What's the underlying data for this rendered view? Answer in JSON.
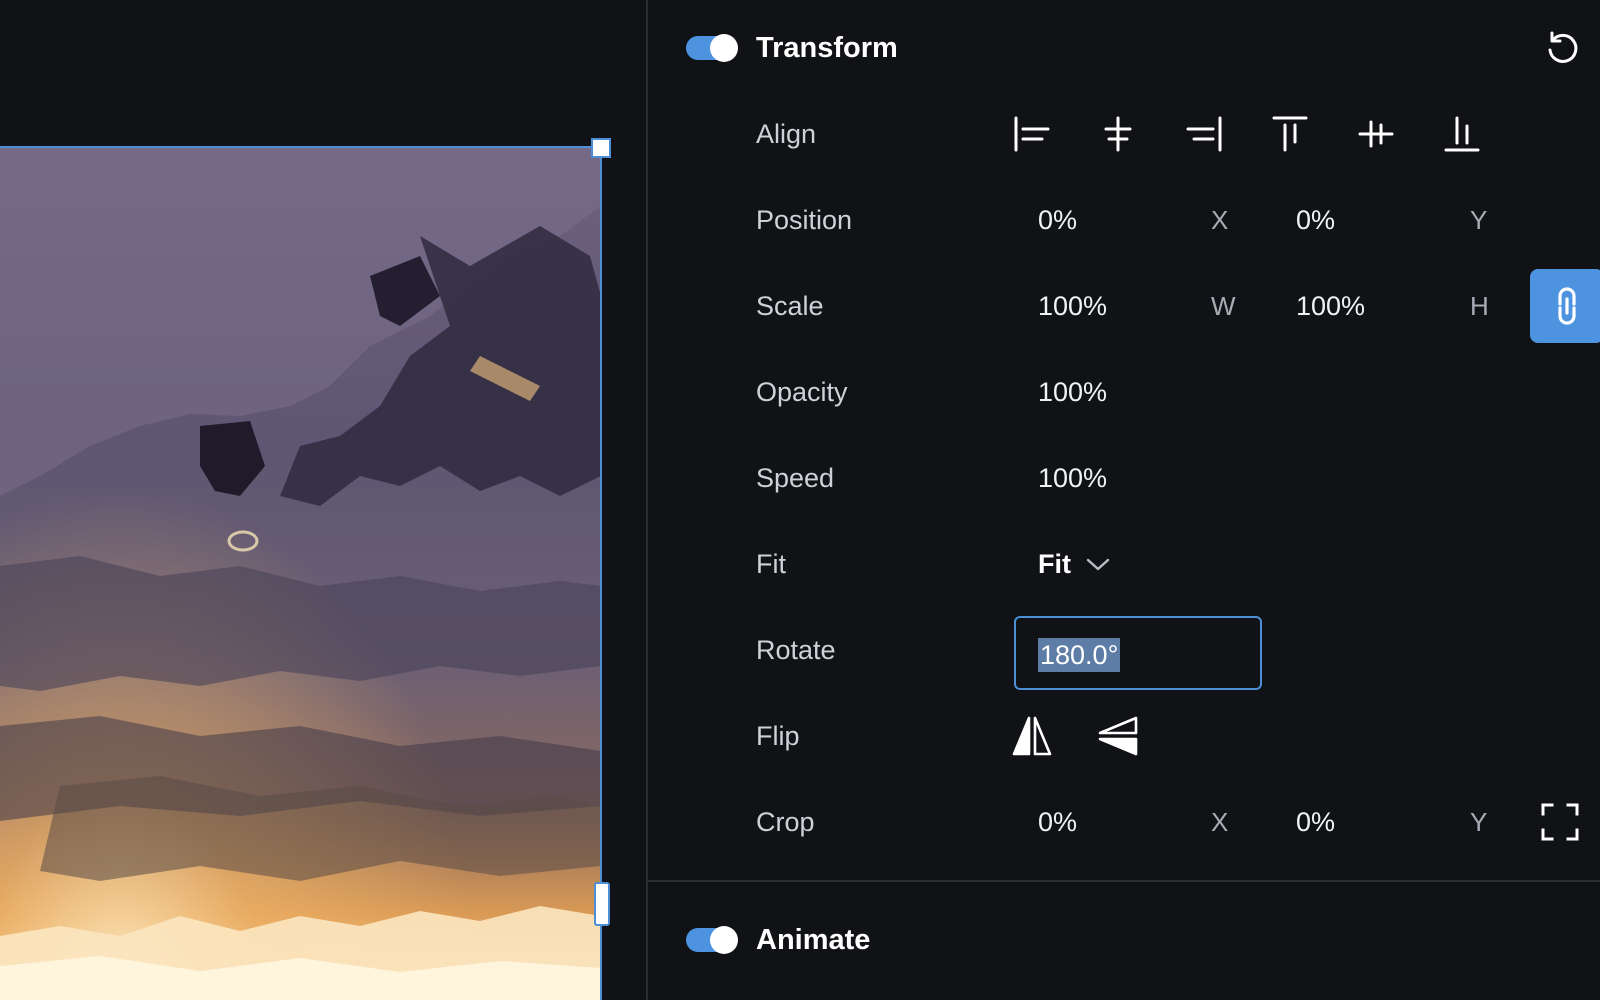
{
  "transform": {
    "title": "Transform",
    "enabled": true,
    "rows": {
      "align": {
        "label": "Align"
      },
      "position": {
        "label": "Position",
        "x_value": "0%",
        "x_axis": "X",
        "y_value": "0%",
        "y_axis": "Y"
      },
      "scale": {
        "label": "Scale",
        "w_value": "100%",
        "w_axis": "W",
        "h_value": "100%",
        "h_axis": "H",
        "linked": true
      },
      "opacity": {
        "label": "Opacity",
        "value": "100%"
      },
      "speed": {
        "label": "Speed",
        "value": "100%"
      },
      "fit": {
        "label": "Fit",
        "value": "Fit"
      },
      "rotate": {
        "label": "Rotate",
        "value": "180.0°"
      },
      "flip": {
        "label": "Flip"
      },
      "crop": {
        "label": "Crop",
        "x_value": "0%",
        "x_axis": "X",
        "y_value": "0%",
        "y_axis": "Y"
      }
    }
  },
  "animate": {
    "title": "Animate",
    "enabled": true
  },
  "icons": {
    "reset": "reset-icon",
    "align_left": "align-left-icon",
    "align_center_h": "align-center-horizontal-icon",
    "align_right": "align-right-icon",
    "align_top": "align-top-icon",
    "align_middle_v": "align-middle-vertical-icon",
    "align_bottom": "align-bottom-icon",
    "link": "link-icon",
    "chevron": "chevron-down-icon",
    "flip_horizontal": "flip-horizontal-icon",
    "flip_vertical": "flip-vertical-icon",
    "crop": "crop-icon"
  },
  "colors": {
    "background": "#111215",
    "accent": "#4d93e0",
    "selection_outline": "#4c8fd6",
    "divider": "#2b2d33",
    "text_selection": "#5e7da6"
  }
}
